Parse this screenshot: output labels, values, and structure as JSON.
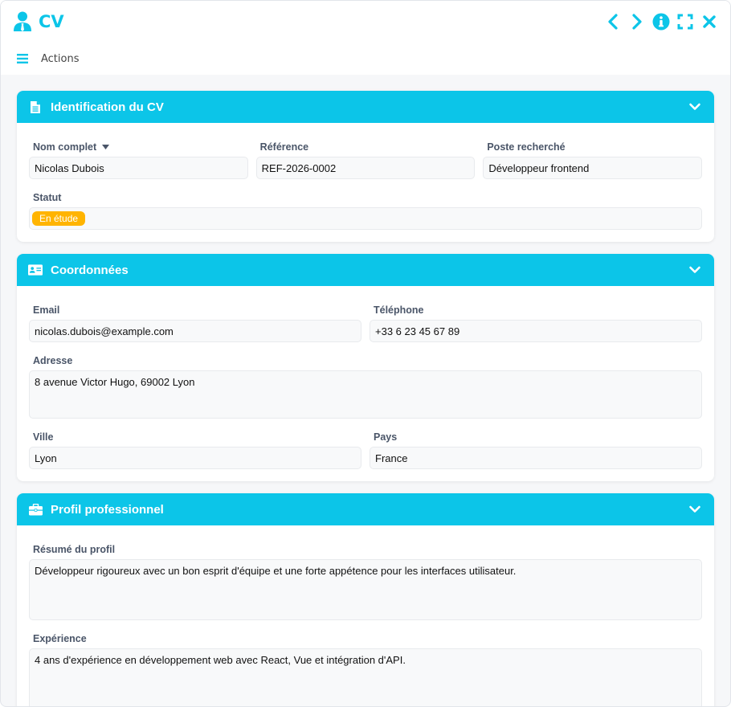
{
  "window": {
    "title": "CV"
  },
  "toolbar": {
    "actions_label": "Actions"
  },
  "colors": {
    "accent": "#0cc5e8",
    "status_badge": "#ffb400"
  },
  "sections": {
    "identification": {
      "title": "Identification du CV",
      "fields": {
        "nom_complet": {
          "label": "Nom complet",
          "value": "Nicolas Dubois"
        },
        "reference": {
          "label": "Référence",
          "value": "REF-2026-0002"
        },
        "poste": {
          "label": "Poste recherché",
          "value": "Développeur frontend"
        },
        "statut": {
          "label": "Statut",
          "value": "En étude"
        }
      }
    },
    "coordonnees": {
      "title": "Coordonnées",
      "fields": {
        "email": {
          "label": "Email",
          "value": "nicolas.dubois@example.com"
        },
        "telephone": {
          "label": "Téléphone",
          "value": "+33 6 23 45 67 89"
        },
        "adresse": {
          "label": "Adresse",
          "value": "8 avenue Victor Hugo, 69002 Lyon"
        },
        "ville": {
          "label": "Ville",
          "value": "Lyon"
        },
        "pays": {
          "label": "Pays",
          "value": "France"
        }
      }
    },
    "profil": {
      "title": "Profil professionnel",
      "fields": {
        "resume": {
          "label": "Résumé du profil",
          "value": "Développeur rigoureux avec un bon esprit d'équipe et une forte appétence pour les interfaces utilisateur."
        },
        "experience": {
          "label": "Expérience",
          "value": "4 ans d'expérience en développement web avec React, Vue et intégration d'API."
        }
      }
    }
  }
}
